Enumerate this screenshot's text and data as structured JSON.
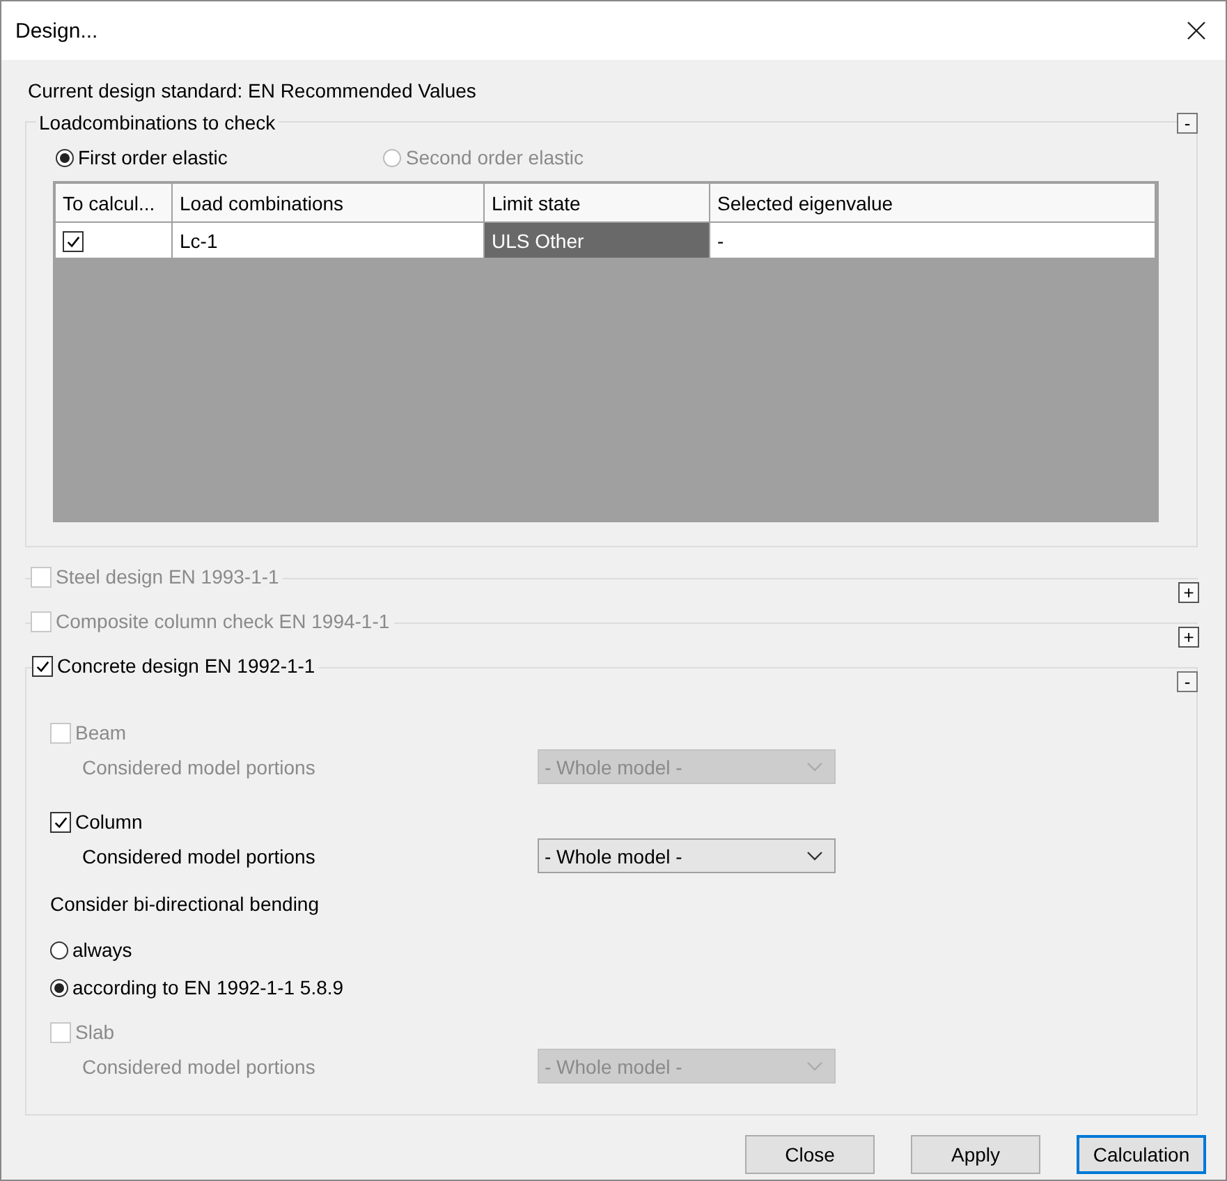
{
  "window": {
    "title": "Design..."
  },
  "standard_label": "Current design standard: EN Recommended Values",
  "loadcombinations": {
    "title": "Loadcombinations to check",
    "toggle": "-",
    "expanded": true,
    "analysis_options": [
      {
        "label": "First order elastic",
        "selected": true,
        "disabled": false
      },
      {
        "label": "Second order elastic",
        "selected": false,
        "disabled": true
      }
    ],
    "table": {
      "columns": [
        "To calcul...",
        "Load combinations",
        "Limit state",
        "Selected eigenvalue"
      ],
      "rows": [
        {
          "to_calculate": {
            "checked": true
          },
          "load_combination": "Lc-1",
          "limit_state": "ULS Other",
          "limit_state_selected": true,
          "eigenvalue": "-"
        }
      ]
    }
  },
  "sections": [
    {
      "label": "Steel design EN 1993-1-1",
      "checked": false,
      "disabled": true,
      "toggle": "+",
      "expanded": false
    },
    {
      "label": "Composite column check EN 1994-1-1",
      "checked": false,
      "disabled": true,
      "toggle": "+",
      "expanded": false
    },
    {
      "label": "Concrete design EN 1992-1-1",
      "checked": true,
      "disabled": false,
      "toggle": "-",
      "expanded": true,
      "items": [
        {
          "kind": "member",
          "label": "Beam",
          "checked": false,
          "disabled": true,
          "portions_label": "Considered model portions",
          "portions_value": "- Whole model -"
        },
        {
          "kind": "member",
          "label": "Column",
          "checked": true,
          "disabled": false,
          "portions_label": "Considered model portions",
          "portions_value": "- Whole model -"
        },
        {
          "kind": "radio-group",
          "label": "Consider bi-directional bending",
          "options": [
            {
              "label": "always",
              "selected": false
            },
            {
              "label": "according to EN 1992-1-1 5.8.9",
              "selected": true
            }
          ]
        },
        {
          "kind": "member",
          "label": "Slab",
          "checked": false,
          "disabled": true,
          "portions_label": "Considered model portions",
          "portions_value": "- Whole model -"
        }
      ]
    }
  ],
  "buttons": [
    {
      "label": "Close",
      "default": false
    },
    {
      "label": "Apply",
      "default": false
    },
    {
      "label": "Calculation",
      "default": true
    }
  ]
}
